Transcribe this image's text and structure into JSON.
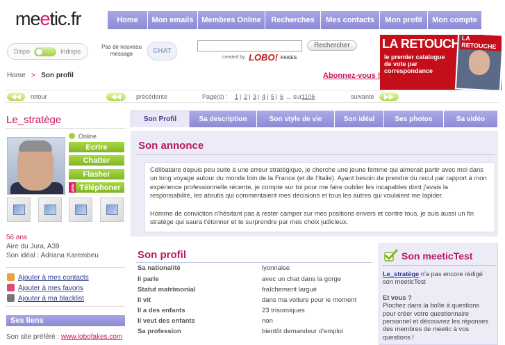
{
  "header": {
    "logo_pre": "me",
    "logo_accent": "e",
    "logo_post": "tic.fr",
    "nav": [
      "Home",
      "Mon emails",
      "Membres Online",
      "Recherches",
      "Mes contacts",
      "Mon profil",
      "Mon compte"
    ]
  },
  "status": {
    "dispo": "Dispo",
    "indispo": "Indispo",
    "no_new_message": "Pas de nouveau message",
    "chat_button": "CHAT"
  },
  "search": {
    "placeholder": "",
    "button": "Rechercher",
    "created_by": "created by",
    "brand": "LOBO",
    "brand_mark": "!",
    "brand_suffix": "FAKES"
  },
  "ad": {
    "headline": "LA RETOUCHE",
    "subline": "le premier catalogue de vote par correspondance",
    "book_title": "LA RETOUCHE"
  },
  "breadcrumb": {
    "home": "Home",
    "separator": ">",
    "current": "Son profil"
  },
  "abonnez": "Abonnez-vous !",
  "pager": {
    "back": "retour",
    "prev": "précédente",
    "pages_label": "Page(s) :",
    "pages": [
      "1",
      "2",
      "3",
      "4",
      "5",
      "6"
    ],
    "ellipsis": "... sur",
    "total": "1106",
    "next": "suivante"
  },
  "user": {
    "name": "Le_stratège",
    "online": "Online",
    "actions": [
      "Ecrire",
      "Chatter",
      "Flasher",
      "Téléphoner"
    ],
    "new_badge": "NEW",
    "age": "56 ans",
    "location": "Aire du Jura, A39",
    "ideal": "Son idéal : Adriana Karembeu",
    "links": [
      "Ajouter à mes contacts",
      "Ajouter à mes favoris",
      "Ajouter à ma blacklist"
    ],
    "liens_title": "Ses liens",
    "site_label": "Son site préféré :",
    "site_url": "www.lobofakes.com"
  },
  "tabs": [
    "Son Profil",
    "Sa description",
    "Son style de vie",
    "Son idéal",
    "Ses photos",
    "Sa vidéo"
  ],
  "annonce": {
    "title": "Son annonce",
    "p1": "Célibataire depuis peu suite à une erreur stratégique, je cherche une jeune femme qui aimerait partir avec moi dans un long voyage autour du monde loin de la France (et de l'Italie). Ayant besoin de prendre du recul par rapport à mon expérience professionnelle récente, je compte sur toi pour me faire oublier les incapables dont j'avais la responsabilité, les abrutis qui commentaient mes décisions et tous les autres qui voulaient me lapider.",
    "p2": "Homme de conviction n'hésitant pas à rester camper sur mes positions envers et contre tous, je suis aussi un fin stratège qui saura t'étonner et te surprendre par mes choix judicieux."
  },
  "profil": {
    "title": "Son profil",
    "rows": [
      {
        "label": "Sa nationalité",
        "value": "lyonnaise"
      },
      {
        "label": "Il parle",
        "value": "avec un chat dans la gorge"
      },
      {
        "label": "Statut matrimonial",
        "value": "fraîchement largué"
      },
      {
        "label": "Il vit",
        "value": "dans ma voiture pour le moment"
      },
      {
        "label": "Il a des enfants",
        "value": "23 trisomiques"
      },
      {
        "label": "Il veut des enfants",
        "value": "non"
      },
      {
        "label": "Sa profession",
        "value": "bientôt demandeur d'emploi"
      }
    ]
  },
  "meetictest": {
    "title": "Son meeticTest",
    "user": "Le_stratège",
    "not_done": "n'a pas encore rédigé son meeticTest",
    "question": "Et vous ?",
    "body": "Piochez dans la boîte à questions pour créer votre questionnaire personnel et découvrez les réponses des membres de meetic à vos questions !"
  },
  "colors": {
    "accent": "#c8135e",
    "nav": "#9a97dc",
    "green": "#8cc232",
    "panel": "#ecebf6"
  }
}
